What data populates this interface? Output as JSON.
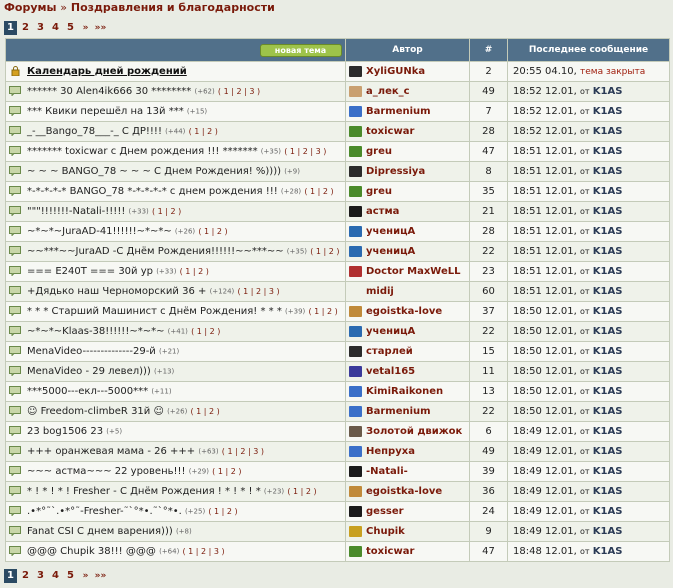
{
  "breadcrumb": {
    "root": "Форумы",
    "sep": "»",
    "current": "Поздравления и благодарности"
  },
  "pager": {
    "pages": [
      "1",
      "2",
      "3",
      "4",
      "5"
    ],
    "current": "1",
    "next": "»",
    "last": "»»"
  },
  "table": {
    "new_topic": "новая тема",
    "col_author": "Автор",
    "col_count": "#",
    "col_last": "Последнее сообщение",
    "last_prefix": "от",
    "rows": [
      {
        "title": "Календарь дней рождений",
        "bold": true,
        "locked": true,
        "tp": "",
        "pages": "",
        "author": "XyliGUNka",
        "av": "#2b2b2b",
        "count": "2",
        "time": "20:55 04.10,",
        "status": "тема закрыта",
        "who": ""
      },
      {
        "title": "****** 30 Alen4ik666 30 ********",
        "tp": "(+62)",
        "pages": "( 1 | 2 | 3 )",
        "author": "а_лек_с",
        "av": "#c9a070",
        "count": "49",
        "time": "18:52 12.01,",
        "who": "K1AS"
      },
      {
        "title": "*** Квики перешёл на 13й ***",
        "tp": "(+15)",
        "pages": "",
        "author": "Barmenium",
        "av": "#3a6fc8",
        "count": "7",
        "time": "18:52 12.01,",
        "who": "K1AS"
      },
      {
        "title": "_-__Bango_78___-_ С ДР!!!!",
        "tp": "(+44)",
        "pages": "( 1 | 2 )",
        "author": "toxicwar",
        "av": "#4a8a2a",
        "count": "28",
        "time": "18:52 12.01,",
        "who": "K1AS"
      },
      {
        "title": "******* toxicwar с Днем рождения !!! *******",
        "tp": "(+35)",
        "pages": "( 1 | 2 | 3 )",
        "author": "greu",
        "av": "#4a8a2a",
        "count": "47",
        "time": "18:51 12.01,",
        "who": "K1AS"
      },
      {
        "title": "~ ~ ~ BANGO_78 ~ ~ ~ С Днем Рождения! %))))",
        "tp": "(+9)",
        "pages": "",
        "author": "Dipressiya",
        "av": "#2b2b2b",
        "count": "8",
        "time": "18:51 12.01,",
        "who": "K1AS"
      },
      {
        "title": "*-*-*-*-* BANGO_78 *-*-*-*-* с днем рождения !!!",
        "tp": "(+28)",
        "pages": "( 1 | 2 )",
        "author": "greu",
        "av": "#4a8a2a",
        "count": "35",
        "time": "18:51 12.01,",
        "who": "K1AS"
      },
      {
        "title": "\"\"\"!!!!!!!-Natali-!!!!!",
        "tp": "(+33)",
        "pages": "( 1 | 2 )",
        "author": "астма",
        "av": "#1a1a1a",
        "count": "21",
        "time": "18:51 12.01,",
        "who": "K1AS"
      },
      {
        "title": "~*~*~JuraAD-41!!!!!!~*~*~",
        "tp": "(+26)",
        "pages": "( 1 | 2 )",
        "author": "ученицА",
        "av": "#2a6ab0",
        "count": "28",
        "time": "18:51 12.01,",
        "who": "K1AS"
      },
      {
        "title": "~~***~~JuraAD -С Днём Рождения!!!!!!~~***~~",
        "tp": "(+35)",
        "pages": "( 1 | 2 )",
        "author": "ученицА",
        "av": "#2a6ab0",
        "count": "22",
        "time": "18:51 12.01,",
        "who": "K1AS"
      },
      {
        "title": "=== E240T === 30й ур",
        "tp": "(+33)",
        "pages": "( 1 | 2 )",
        "author": "Doctor MaxWeLL",
        "av": "#b03030",
        "count": "23",
        "time": "18:51 12.01,",
        "who": "K1AS"
      },
      {
        "title": "+Дядько наш Черноморский 36 +",
        "tp": "(+124)",
        "pages": "( 1 | 2 | 3 )",
        "author": "midij",
        "av": "",
        "count": "60",
        "time": "18:51 12.01,",
        "who": "K1AS"
      },
      {
        "title": "* * * Старший Машинист с Днём Рождения! * * *",
        "tp": "(+39)",
        "pages": "( 1 | 2 )",
        "author": "egoistka-love",
        "av": "#c08a3a",
        "count": "37",
        "time": "18:50 12.01,",
        "who": "K1AS"
      },
      {
        "title": "~*~*~Klaas-38!!!!!!~*~*~",
        "tp": "(+41)",
        "pages": "( 1 | 2 )",
        "author": "ученицА",
        "av": "#2a6ab0",
        "count": "22",
        "time": "18:50 12.01,",
        "who": "K1AS"
      },
      {
        "title": "MenaVideo--------------29-й",
        "tp": "(+21)",
        "pages": "",
        "author": "старлей",
        "av": "#2b2b2b",
        "count": "15",
        "time": "18:50 12.01,",
        "who": "K1AS"
      },
      {
        "title": "MenaVideo - 29 левел)))",
        "tp": "(+13)",
        "pages": "",
        "author": "vetal165",
        "av": "#3a3a9a",
        "count": "11",
        "time": "18:50 12.01,",
        "who": "K1AS"
      },
      {
        "title": "***5000---екл---5000***",
        "tp": "(+11)",
        "pages": "",
        "author": "KimiRaikonen",
        "av": "#3a6fc8",
        "count": "13",
        "time": "18:50 12.01,",
        "who": "K1AS"
      },
      {
        "title": "☺ Freedom-climbeR 31й ☺",
        "tp": "(+26)",
        "pages": "( 1 | 2 )",
        "author": "Barmenium",
        "av": "#3a6fc8",
        "count": "22",
        "time": "18:50 12.01,",
        "who": "K1AS"
      },
      {
        "title": "23 bog1506 23",
        "tp": "(+5)",
        "pages": "",
        "author": "Золотой движок",
        "av": "#6a5a4a",
        "count": "6",
        "time": "18:49 12.01,",
        "who": "K1AS"
      },
      {
        "title": "+++ оранжевая мама - 26 +++",
        "tp": "(+63)",
        "pages": "( 1 | 2 | 3 )",
        "author": "Непруха",
        "av": "#3a6fc8",
        "count": "49",
        "time": "18:49 12.01,",
        "who": "K1AS"
      },
      {
        "title": "~~~ астма~~~ 22 уровень!!!",
        "tp": "(+29)",
        "pages": "( 1 | 2 )",
        "author": "-Natali-",
        "av": "#1a1a1a",
        "count": "39",
        "time": "18:49 12.01,",
        "who": "K1AS"
      },
      {
        "title": "* ! * ! * ! Fresher - С Днём Рождения ! * ! * ! *",
        "tp": "(+23)",
        "pages": "( 1 | 2 )",
        "author": "egoistka-love",
        "av": "#c08a3a",
        "count": "36",
        "time": "18:49 12.01,",
        "who": "K1AS"
      },
      {
        "title": ".•*°˜`.•*°˜-Fresher-˜`°*•.˜`°*•.",
        "tp": "(+25)",
        "pages": "( 1 | 2 )",
        "author": "gesser",
        "av": "#1a1a1a",
        "count": "24",
        "time": "18:49 12.01,",
        "who": "K1AS"
      },
      {
        "title": "Fanat CSI С днем варения)))",
        "tp": "(+8)",
        "pages": "",
        "author": "Chupik",
        "av": "#c8a020",
        "count": "9",
        "time": "18:49 12.01,",
        "who": "K1AS"
      },
      {
        "title": "@@@ Chupik 38!!! @@@",
        "tp": "(+64)",
        "pages": "( 1 | 2 | 3 )",
        "author": "toxicwar",
        "av": "#4a8a2a",
        "count": "47",
        "time": "18:48 12.01,",
        "who": "K1AS"
      }
    ]
  },
  "colors": {
    "header": "#51708a",
    "link": "#7a1a0a",
    "button": "#9ec34a"
  }
}
